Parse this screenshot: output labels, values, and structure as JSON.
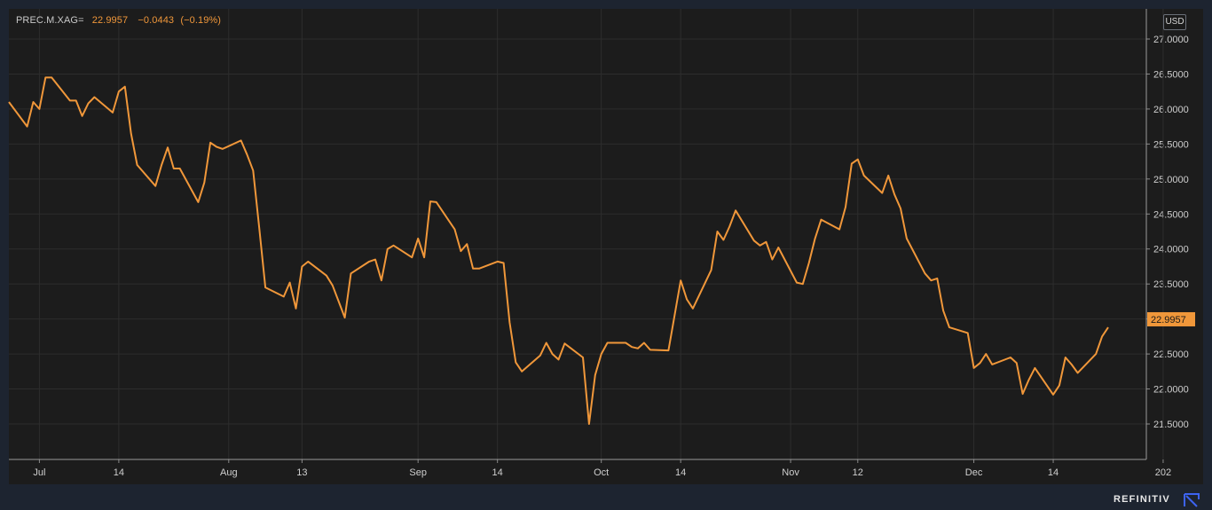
{
  "header": {
    "instrument": "PREC.M.XAG=",
    "last": "22.9957",
    "change": "−0.0443",
    "change_pct": "(−0.19%)",
    "currency": "USD"
  },
  "brand": {
    "name": "REFINITIV"
  },
  "colors": {
    "line": "#f0973a",
    "plot_bg": "#1c1c1c",
    "page_bg": "#1d2430",
    "grid": "#2d2d2d",
    "text": "#cfcfcf",
    "brand_icon": "#3d63f0"
  },
  "chart_data": {
    "type": "line",
    "title": "",
    "xlabel": "",
    "ylabel": "",
    "ylim": [
      21.2,
      27.3
    ],
    "grid": true,
    "legend": "top-left",
    "last_value_label": "22.9957",
    "y_ticks": [
      {
        "value": 27.0,
        "label": "27.0000"
      },
      {
        "value": 26.5,
        "label": "26.5000"
      },
      {
        "value": 26.0,
        "label": "26.0000"
      },
      {
        "value": 25.5,
        "label": "25.5000"
      },
      {
        "value": 25.0,
        "label": "25.0000"
      },
      {
        "value": 24.5,
        "label": "24.5000"
      },
      {
        "value": 24.0,
        "label": "24.0000"
      },
      {
        "value": 23.5,
        "label": "23.5000"
      },
      {
        "value": 23.0,
        "label": "23.0000"
      },
      {
        "value": 22.5,
        "label": "22.5000"
      },
      {
        "value": 22.0,
        "label": "22.0000"
      },
      {
        "value": 21.5,
        "label": "21.5000"
      }
    ],
    "x_ticks": [
      {
        "date": "2020-07-01",
        "label": "Jul"
      },
      {
        "date": "2020-07-14",
        "label": "14"
      },
      {
        "date": "2020-08-01",
        "label": "Aug"
      },
      {
        "date": "2020-08-13",
        "label": "13"
      },
      {
        "date": "2020-09-01",
        "label": "Sep"
      },
      {
        "date": "2020-09-14",
        "label": "14"
      },
      {
        "date": "2020-10-01",
        "label": "Oct"
      },
      {
        "date": "2020-10-14",
        "label": "14"
      },
      {
        "date": "2020-11-01",
        "label": "Nov"
      },
      {
        "date": "2020-11-12",
        "label": "12"
      },
      {
        "date": "2020-12-01",
        "label": "Dec"
      },
      {
        "date": "2020-12-14",
        "label": "14"
      },
      {
        "date": "2021-01-01",
        "label": "202"
      }
    ],
    "series": [
      {
        "dates": [
          "2020-06-26",
          "2020-06-29",
          "2020-06-30",
          "2020-07-01",
          "2020-07-02",
          "2020-07-03",
          "2020-07-06",
          "2020-07-07",
          "2020-07-08",
          "2020-07-09",
          "2020-07-10",
          "2020-07-13",
          "2020-07-14",
          "2020-07-15",
          "2020-07-16",
          "2020-07-17",
          "2020-07-20",
          "2020-07-21",
          "2020-07-22",
          "2020-07-23",
          "2020-07-24",
          "2020-07-27",
          "2020-07-28",
          "2020-07-29",
          "2020-07-30",
          "2020-07-31",
          "2020-08-03",
          "2020-08-04",
          "2020-08-05",
          "2020-08-06",
          "2020-08-07",
          "2020-08-10",
          "2020-08-11",
          "2020-08-12",
          "2020-08-13",
          "2020-08-14",
          "2020-08-17",
          "2020-08-18",
          "2020-08-19",
          "2020-08-20",
          "2020-08-21",
          "2020-08-24",
          "2020-08-25",
          "2020-08-26",
          "2020-08-27",
          "2020-08-28",
          "2020-08-31",
          "2020-09-01",
          "2020-09-02",
          "2020-09-03",
          "2020-09-04",
          "2020-09-07",
          "2020-09-08",
          "2020-09-09",
          "2020-09-10",
          "2020-09-11",
          "2020-09-14",
          "2020-09-15",
          "2020-09-16",
          "2020-09-17",
          "2020-09-18",
          "2020-09-21",
          "2020-09-22",
          "2020-09-23",
          "2020-09-24",
          "2020-09-25",
          "2020-09-28",
          "2020-09-29",
          "2020-09-30",
          "2020-10-01",
          "2020-10-02",
          "2020-10-05",
          "2020-10-06",
          "2020-10-07",
          "2020-10-08",
          "2020-10-09",
          "2020-10-12",
          "2020-10-13",
          "2020-10-14",
          "2020-10-15",
          "2020-10-16",
          "2020-10-19",
          "2020-10-20",
          "2020-10-21",
          "2020-10-22",
          "2020-10-23",
          "2020-10-26",
          "2020-10-27",
          "2020-10-28",
          "2020-10-29",
          "2020-10-30",
          "2020-11-02",
          "2020-11-03",
          "2020-11-04",
          "2020-11-05",
          "2020-11-06",
          "2020-11-09",
          "2020-11-10",
          "2020-11-11",
          "2020-11-12",
          "2020-11-13",
          "2020-11-16",
          "2020-11-17",
          "2020-11-18",
          "2020-11-19",
          "2020-11-20",
          "2020-11-23",
          "2020-11-24",
          "2020-11-25",
          "2020-11-26",
          "2020-11-27",
          "2020-11-30",
          "2020-12-01",
          "2020-12-02",
          "2020-12-03",
          "2020-12-04",
          "2020-12-07",
          "2020-12-08",
          "2020-12-09",
          "2020-12-10",
          "2020-12-11",
          "2020-12-14",
          "2020-12-15",
          "2020-12-16",
          "2020-12-17",
          "2020-12-18",
          "2020-12-21",
          "2020-12-22",
          "2020-12-23"
        ],
        "values": [
          26.1,
          25.75,
          26.1,
          26.0,
          26.45,
          26.45,
          26.12,
          26.12,
          25.9,
          26.08,
          26.17,
          25.95,
          26.25,
          26.32,
          25.65,
          25.2,
          24.9,
          25.2,
          25.45,
          25.15,
          25.15,
          24.67,
          24.95,
          25.52,
          25.46,
          25.43,
          25.55,
          25.35,
          25.12,
          24.3,
          23.45,
          23.32,
          23.52,
          23.15,
          23.75,
          23.82,
          23.62,
          23.48,
          23.25,
          23.02,
          23.65,
          23.82,
          23.85,
          23.55,
          24.0,
          24.05,
          23.88,
          24.15,
          23.88,
          24.68,
          24.67,
          24.28,
          23.97,
          24.07,
          23.72,
          23.72,
          23.82,
          23.8,
          22.95,
          22.38,
          22.25,
          22.48,
          22.66,
          22.5,
          22.42,
          22.65,
          22.45,
          21.5,
          22.2,
          22.5,
          22.66,
          22.66,
          22.6,
          22.58,
          22.66,
          22.56,
          22.55,
          23.05,
          23.55,
          23.28,
          23.15,
          23.7,
          24.25,
          24.13,
          24.32,
          24.55,
          24.12,
          24.05,
          24.1,
          23.85,
          24.02,
          23.52,
          23.5,
          23.8,
          24.15,
          24.42,
          24.28,
          24.6,
          25.22,
          25.28,
          25.05,
          24.8,
          25.05,
          24.78,
          24.58,
          24.15,
          23.65,
          23.55,
          23.58,
          23.12,
          22.88,
          22.8,
          22.3,
          22.37,
          22.5,
          22.35,
          22.45,
          22.37,
          21.93,
          22.13,
          22.3,
          21.92,
          22.05,
          22.45,
          22.35,
          22.23,
          22.5,
          22.75,
          22.88,
          22.92,
          23.03,
          22.9957
        ]
      }
    ]
  }
}
